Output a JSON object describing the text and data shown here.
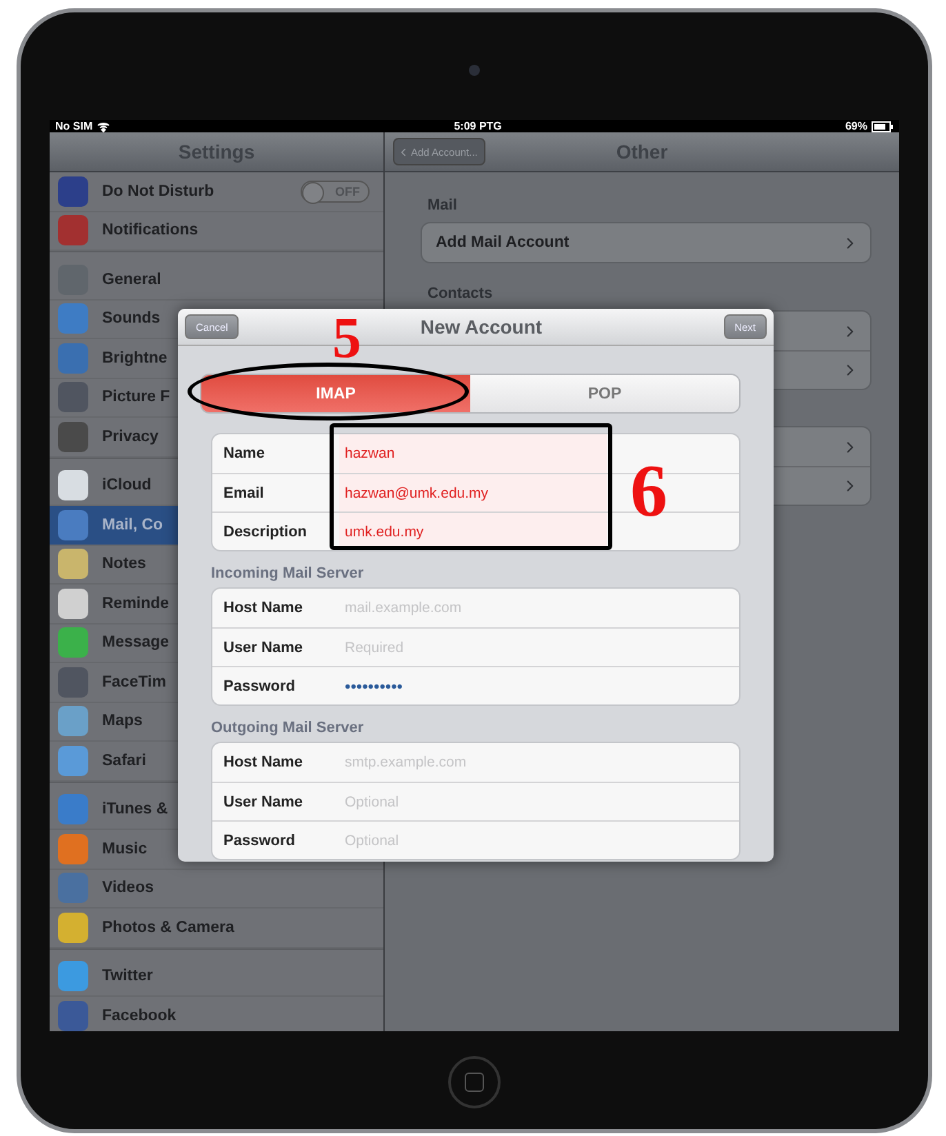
{
  "status_bar": {
    "carrier": "No SIM",
    "time": "5:09 PTG",
    "battery": "69%"
  },
  "sidebar": {
    "title": "Settings",
    "groups": [
      {
        "items": [
          {
            "label": "Do Not Disturb",
            "selected": false,
            "switch": {
              "label": "OFF",
              "on": false
            }
          },
          {
            "label": "Notifications",
            "selected": false
          }
        ]
      },
      {
        "items": [
          {
            "label": "General",
            "selected": false
          },
          {
            "label": "Sounds",
            "selected": false
          },
          {
            "label": "Brightne",
            "selected": false
          },
          {
            "label": "Picture F",
            "selected": false
          },
          {
            "label": "Privacy",
            "selected": false
          }
        ]
      },
      {
        "items": [
          {
            "label": "iCloud",
            "selected": false
          },
          {
            "label": "Mail, Co",
            "selected": true
          },
          {
            "label": "Notes",
            "selected": false
          },
          {
            "label": "Reminde",
            "selected": false
          },
          {
            "label": "Message",
            "selected": false
          },
          {
            "label": "FaceTim",
            "selected": false
          },
          {
            "label": "Maps",
            "selected": false
          },
          {
            "label": "Safari",
            "selected": false
          }
        ]
      },
      {
        "items": [
          {
            "label": "iTunes &",
            "selected": false
          },
          {
            "label": "Music",
            "selected": false
          },
          {
            "label": "Videos",
            "selected": false
          },
          {
            "label": "Photos & Camera",
            "selected": false
          }
        ]
      },
      {
        "items": [
          {
            "label": "Twitter",
            "selected": false
          },
          {
            "label": "Facebook",
            "selected": false
          }
        ]
      }
    ]
  },
  "detail": {
    "back_button": "Add Account...",
    "title": "Other",
    "sections": [
      {
        "header": "Mail",
        "rows": [
          {
            "label": "Add Mail Account"
          }
        ]
      },
      {
        "header": "Contacts",
        "rows": [
          {},
          {}
        ]
      },
      {
        "rows": [
          {},
          {}
        ]
      }
    ]
  },
  "dialog": {
    "cancel": "Cancel",
    "title": "New Account",
    "next": "Next",
    "segments": [
      {
        "label": "IMAP",
        "selected": true
      },
      {
        "label": "POP",
        "selected": false
      }
    ],
    "account_fields": [
      {
        "label": "Name",
        "value": "hazwan"
      },
      {
        "label": "Email",
        "value": "hazwan@umk.edu.my"
      },
      {
        "label": "Description",
        "value": "umk.edu.my"
      }
    ],
    "incoming": {
      "header": "Incoming Mail Server",
      "fields": [
        {
          "label": "Host Name",
          "placeholder": "mail.example.com"
        },
        {
          "label": "User Name",
          "placeholder": "Required"
        },
        {
          "label": "Password",
          "value": "••••••••••",
          "kind": "secret"
        }
      ]
    },
    "outgoing": {
      "header": "Outgoing Mail Server",
      "fields": [
        {
          "label": "Host Name",
          "placeholder": "smtp.example.com"
        },
        {
          "label": "User Name",
          "placeholder": "Optional"
        },
        {
          "label": "Password",
          "placeholder": "Optional"
        }
      ]
    }
  },
  "step_markers": [
    "5",
    "6"
  ]
}
